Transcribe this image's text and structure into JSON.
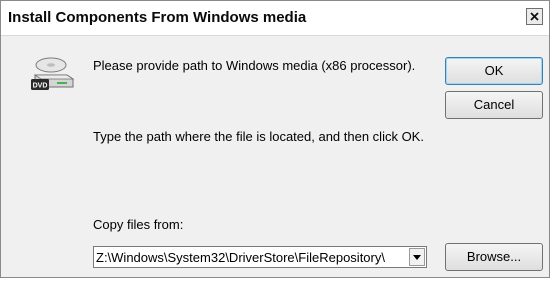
{
  "window": {
    "title": "Install Components From Windows media"
  },
  "icons": {
    "title_close": "close-icon",
    "media": "dvd-drive-icon",
    "dropdown": "chevron-down-icon"
  },
  "dialog": {
    "prompt": "Please provide path to Windows media (x86 processor).",
    "instruction": "Type the path where the file is located, and then click OK.",
    "copy_label": "Copy files from:",
    "path_value": "Z:\\Windows\\System32\\DriverStore\\FileRepository\\"
  },
  "buttons": {
    "ok": "OK",
    "cancel": "Cancel",
    "browse": "Browse..."
  },
  "dvd_badge": "DVD",
  "colors": {
    "dialog_bg": "#f0f0f0",
    "default_button_border": "#3c7fb1"
  }
}
